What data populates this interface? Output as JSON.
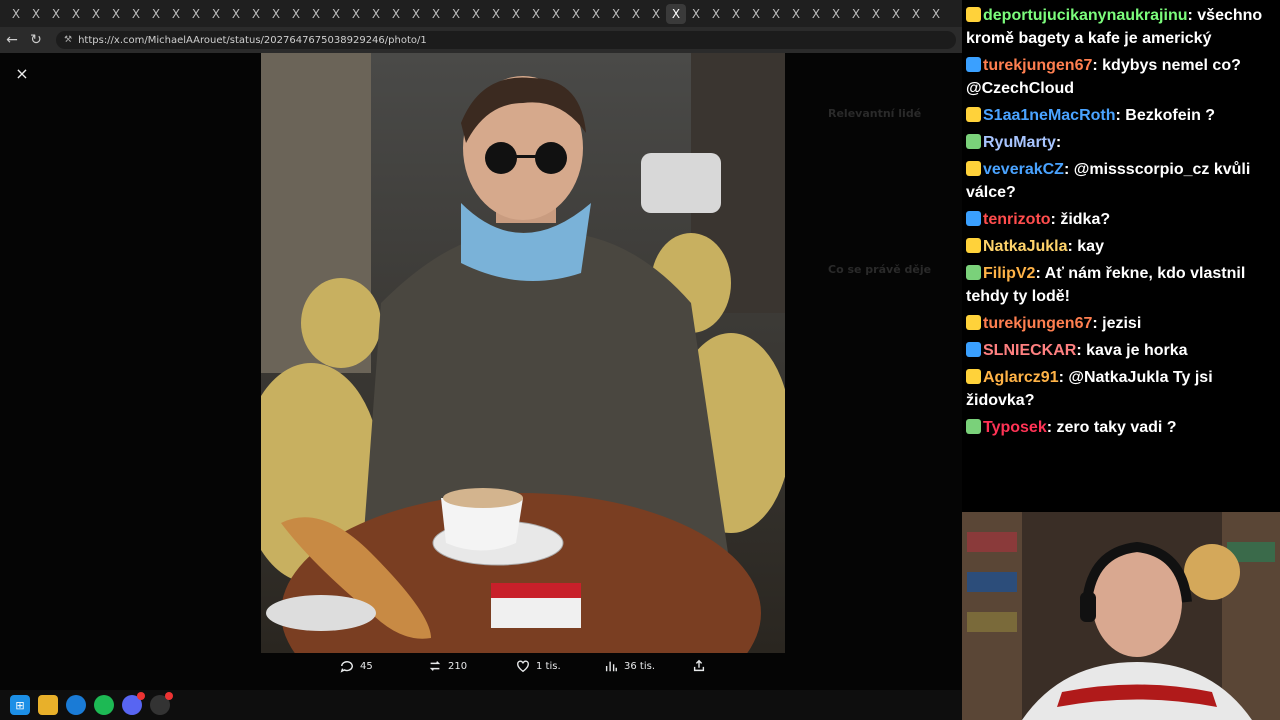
{
  "browser": {
    "url": "https://x.com/MichaelAArouet/status/2027647675038929246/photo/1",
    "tabs": [
      "X",
      "X",
      "X",
      "X",
      "X",
      "X",
      "X",
      "X",
      "X",
      "X",
      "X",
      "X",
      "X",
      "X",
      "X",
      "X",
      "X",
      "X",
      "X",
      "X",
      "X",
      "X",
      "X",
      "X",
      "X",
      "X",
      "X",
      "X",
      "X",
      "X",
      "X",
      "X",
      "X",
      "X",
      "X",
      "X",
      "X",
      "X",
      "X",
      "X",
      "X",
      "X",
      "X",
      "X",
      "X",
      "X",
      "X"
    ]
  },
  "viewer": {
    "close_label": "×",
    "stats": {
      "replies": "45",
      "reposts": "210",
      "likes": "1 tis.",
      "views": "36 tis."
    },
    "background_hints": {
      "relevant_people": "Relevantní lidé",
      "trending": "Co se právě děje"
    }
  },
  "chat": {
    "messages": [
      {
        "user": "deportujucikanynaukrajinu",
        "color": "#7CFC7C",
        "text": "všechno kromě bagety a kafe je americký"
      },
      {
        "user": "turekjungen67",
        "color": "#ff7f50",
        "text": "kdybys nemel co? @CzechCloud"
      },
      {
        "user": "S1aa1neMacRoth",
        "color": "#4aa3ff",
        "text": "Bezkofein ?"
      },
      {
        "user": "RyuMarty",
        "color": "#a8c5ff",
        "text": ""
      },
      {
        "user": "veverakCZ",
        "color": "#4aa3ff",
        "text": "@missscorpio_cz kvůli válce?"
      },
      {
        "user": "tenrizoto",
        "color": "#ff4d4d",
        "text": "židka?"
      },
      {
        "user": "NatkaJukla",
        "color": "#ffd36b",
        "text": "kay"
      },
      {
        "user": "FilipV2",
        "color": "#ffb347",
        "text": "Ať nám řekne, kdo vlastnil tehdy ty lodě!"
      },
      {
        "user": "turekjungen67",
        "color": "#ff7f50",
        "text": "jezisi"
      },
      {
        "user": "SLNIECKAR",
        "color": "#ff8080",
        "text": "kava je horka"
      },
      {
        "user": "Aglarcz91",
        "color": "#ffb347",
        "text": "@NatkaJukla Ty jsi židovka?"
      },
      {
        "user": "Typosek",
        "color": "#ff3355",
        "text": "zero taky vadi ?"
      }
    ]
  },
  "icons": {
    "close": "close-icon",
    "reply": "reply-icon",
    "repost": "repost-icon",
    "like": "heart-icon",
    "views": "views-icon",
    "share": "share-icon"
  }
}
